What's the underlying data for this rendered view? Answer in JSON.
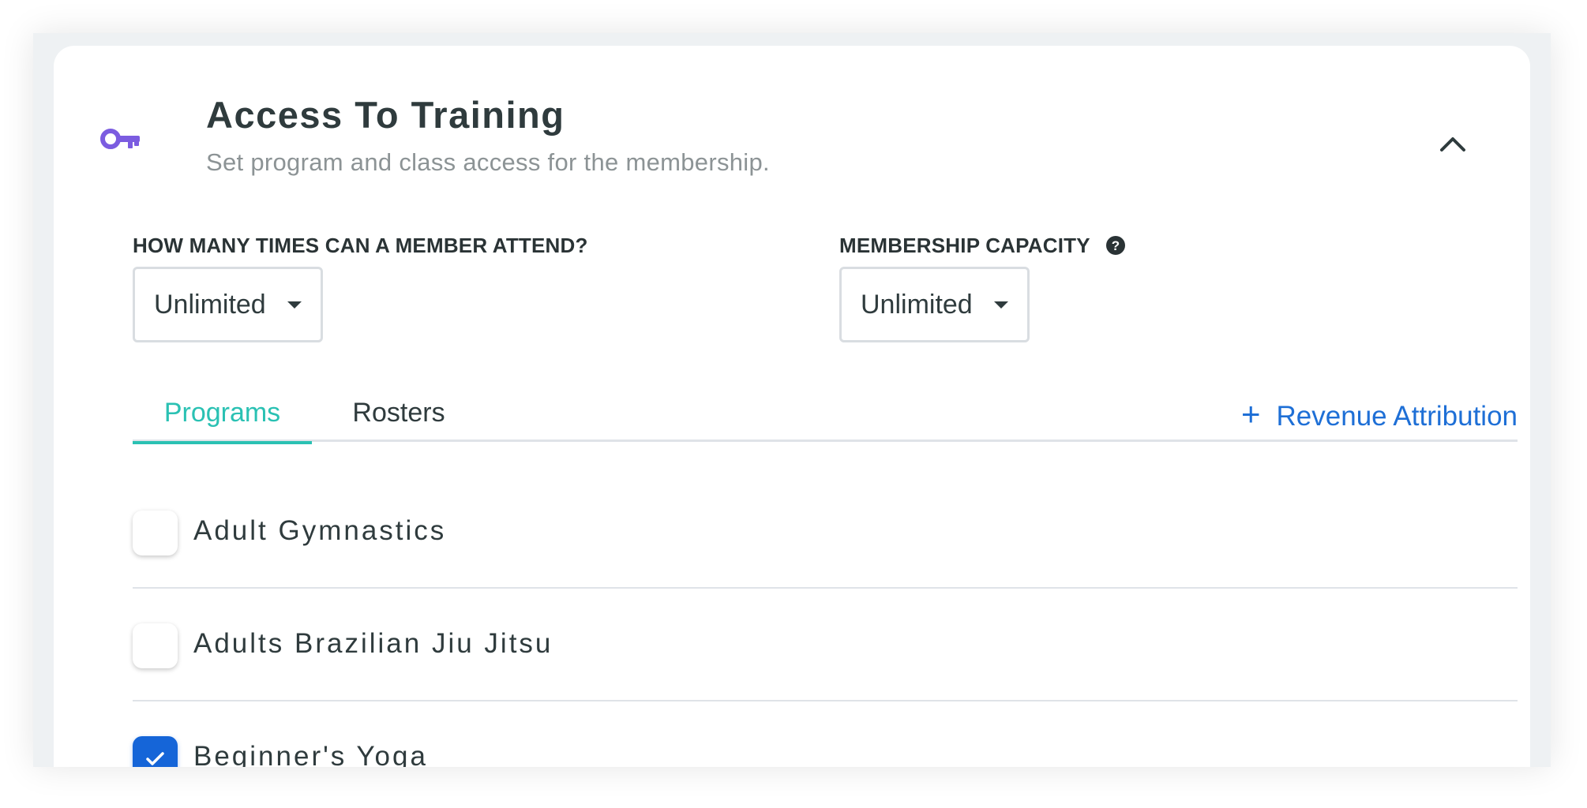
{
  "section": {
    "title": "Access To Training",
    "subtitle": "Set program and class access for the membership.",
    "icon": "key-icon",
    "collapse_icon": "chevron-up-icon"
  },
  "attendance": {
    "label": "HOW MANY TIMES CAN A MEMBER ATTEND?",
    "value": "Unlimited"
  },
  "capacity": {
    "label": "MEMBERSHIP CAPACITY",
    "value": "Unlimited",
    "help_icon": "question-circle-icon"
  },
  "tabs": [
    {
      "label": "Programs",
      "active": true
    },
    {
      "label": "Rosters",
      "active": false
    }
  ],
  "revenue_attribution": {
    "plus": "+",
    "label": "Revenue Attribution"
  },
  "programs": [
    {
      "label": "Adult Gymnastics",
      "checked": false
    },
    {
      "label": "Adults Brazilian Jiu Jitsu",
      "checked": false
    },
    {
      "label": "Beginner's Yoga",
      "checked": true
    }
  ],
  "colors": {
    "accent_teal": "#2ac1b3",
    "link_blue": "#1e6fd6",
    "checkbox_blue": "#1565d8",
    "key_purple": "#7b5ce0"
  }
}
